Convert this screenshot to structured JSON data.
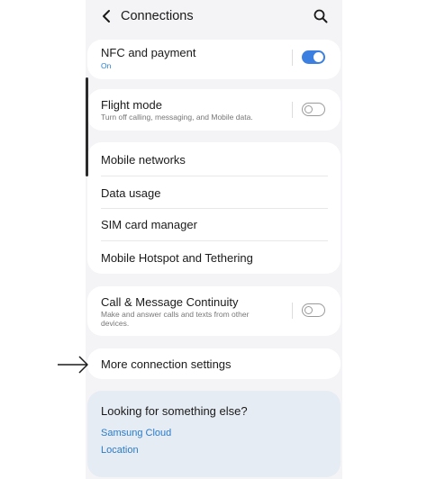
{
  "header": {
    "title": "Connections"
  },
  "nfc": {
    "title": "NFC and payment",
    "status": "On"
  },
  "flight": {
    "title": "Flight mode",
    "subtitle": "Turn off calling, messaging, and Mobile data."
  },
  "network_group": [
    {
      "label": "Mobile networks"
    },
    {
      "label": "Data usage"
    },
    {
      "label": "SIM card manager"
    },
    {
      "label": "Mobile Hotspot and Tethering"
    }
  ],
  "continuity": {
    "title": "Call & Message Continuity",
    "subtitle": "Make and answer calls and texts from other devices."
  },
  "more": {
    "label": "More connection settings"
  },
  "suggestions": {
    "title": "Looking for something else?",
    "links": [
      "Samsung Cloud",
      "Location"
    ]
  },
  "toggles": {
    "nfc": true,
    "flight": false,
    "continuity": false
  },
  "colors": {
    "accent": "#3b7fe0",
    "link": "#2a7bc8",
    "background": "#f4f4f6",
    "suggest_bg": "#e6ecf3"
  }
}
